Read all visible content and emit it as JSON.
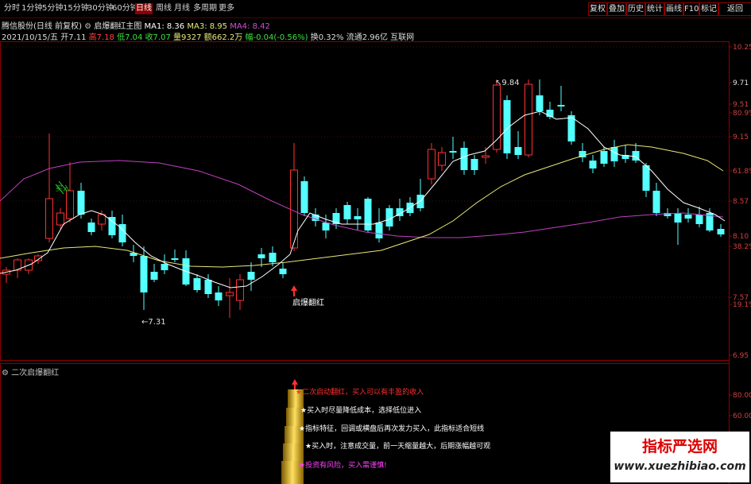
{
  "toolbar": {
    "tabs": [
      "分时",
      "1分钟",
      "5分钟",
      "15分钟",
      "30分钟",
      "60分钟",
      "日线",
      "周线",
      "月线",
      "多周期",
      "更多"
    ],
    "selected_tab": "日线",
    "right_buttons": [
      "复权",
      "叠加",
      "历史",
      "统计",
      "画线",
      "F10",
      "标记",
      "返回"
    ]
  },
  "info": {
    "stock": "腾信股份(日线 前复权)",
    "indicator_name": "启爆翻红主图",
    "ma1": "MA1: 8.36",
    "ma3": "MA3: 8.95",
    "ma4": "MA4: 8.42",
    "date": "2021/10/15/五",
    "open": "开7.11",
    "high": "高7.18",
    "low": "低7.04",
    "close": "收7.07",
    "volume": "量9327",
    "amount": "额662.2万",
    "change": "幅-0.04(-0.56%)",
    "turnover": "换0.32%",
    "float": "流通2.96亿",
    "sector": "互联网"
  },
  "price_axis": {
    "labels": [
      "10.25",
      "9.71",
      "9.51",
      "80.9%",
      "9.15",
      "61.8%",
      "8.57",
      "8.10",
      "38.2%",
      "7.57",
      "19.1%",
      "6.95"
    ]
  },
  "annotations": {
    "high_label": "9.84",
    "low_label": "7.31",
    "signal_label": "启爆翻红",
    "green_label": "买入"
  },
  "sub_chart": {
    "title": "二次启爆翻红",
    "axis_labels": [
      "80.00",
      "60.00"
    ],
    "text_lines": [
      {
        "text": "★二次启动翻红，买入可以有丰盈的收入",
        "color": "#ff3030"
      },
      {
        "text": "★买入时尽量降低成本，选择低位进入",
        "color": "#ffffff"
      },
      {
        "text": "★指标特征，回调或横盘后再次发力买入，此指标适合短线",
        "color": "#ffffff"
      },
      {
        "text": "★买入时，注意成交量，前一天缩量越大，后期涨幅越可观",
        "color": "#ffffff"
      },
      {
        "text": "★投资有风险，买入需谨慎!",
        "color": "#ff40ff"
      }
    ]
  },
  "watermark": {
    "title": "指标严选网",
    "url": "www.xuezhibiao.com"
  },
  "colors": {
    "up": "#ff3030",
    "down": "#54ffff",
    "ma_white": "#ffffff",
    "ma_yellow": "#e8e878",
    "ma_purple": "#c040c0",
    "frame": "#8b0000"
  }
}
